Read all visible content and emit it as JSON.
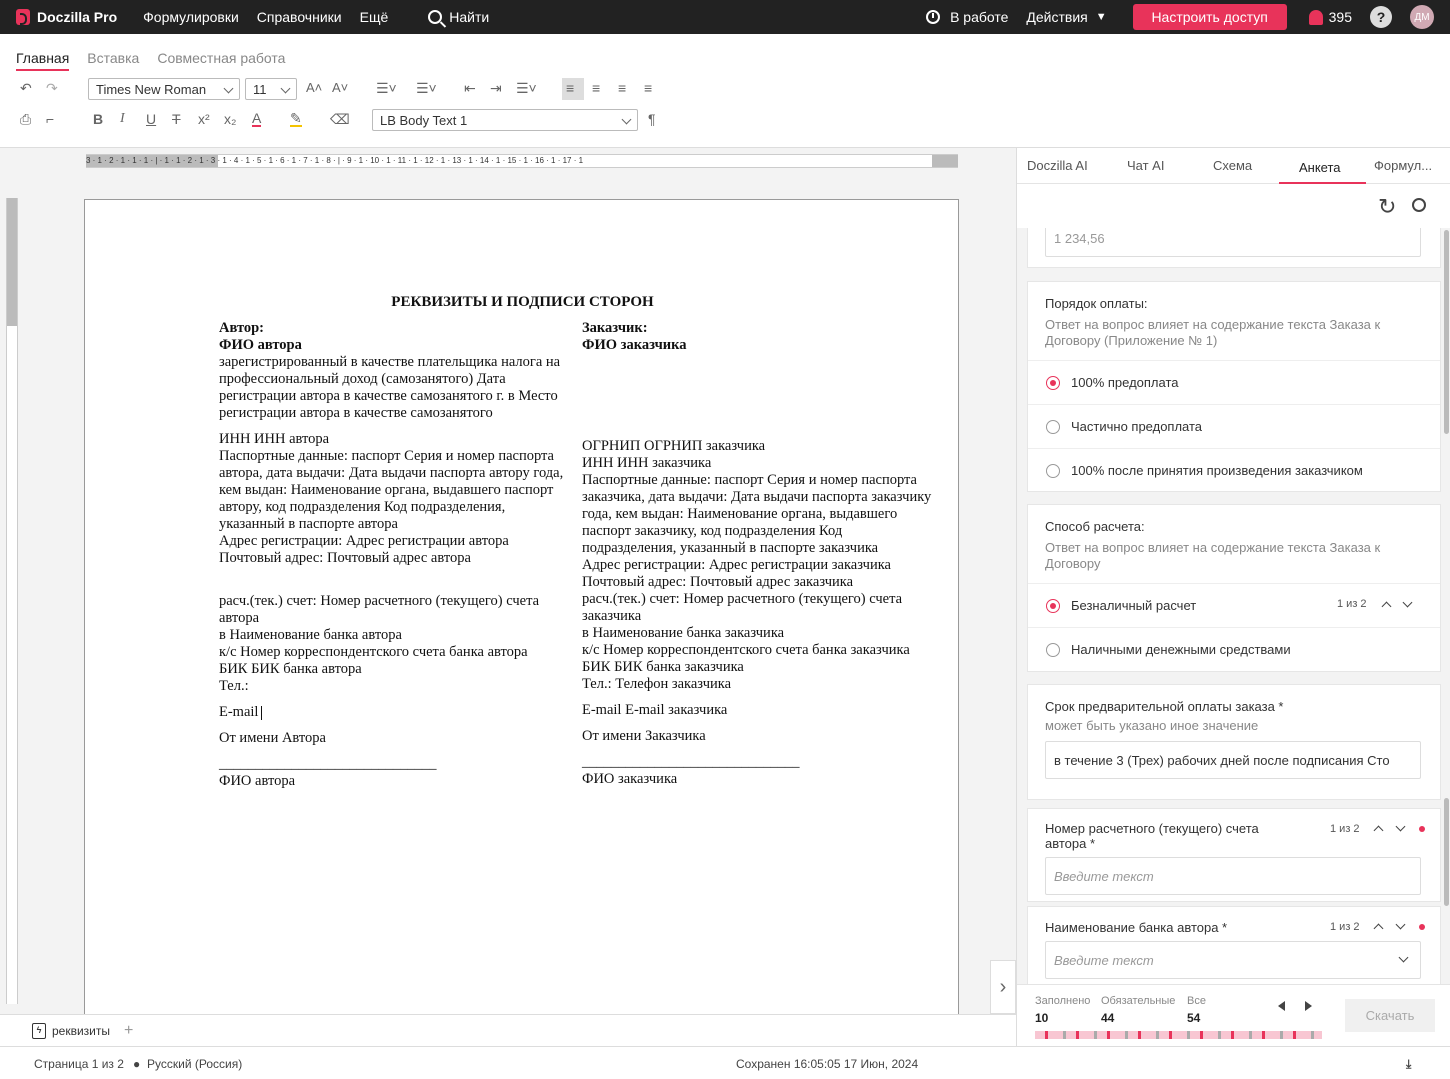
{
  "topbar": {
    "app_name": "Doczilla Pro",
    "nav": [
      "Формулировки",
      "Справочники",
      "Ещё"
    ],
    "search_label": "Найти",
    "status_label": "В работе",
    "actions_label": "Действия",
    "access_button": "Настроить доступ",
    "notifications_count": "395",
    "help_label": "?",
    "avatar_initials": "ДМ",
    "accent_color": "#e8335a"
  },
  "ribbon": {
    "tabs": [
      "Главная",
      "Вставка",
      "Совместная работа"
    ],
    "font_family": "Times New Roman",
    "font_size": "11",
    "style": "LB Body Text 1",
    "pilcrow": "¶"
  },
  "document": {
    "ruler_text": "3 · 1 · 2 · 1 · 1 · 1 · | · 1 · 1 · 2 · 1 · 3 · 1 · 4 · 1 · 5 · 1 · 6 · 1 · 7 · 1 · 8 · | · 9 · 1 · 10 · 1 · 11 · 1 · 12 · 1 · 13 · 1 · 14 · 1 · 15 · 1 · 16 · 1 · 17 · 1",
    "title": "РЕКВИЗИТЫ И ПОДПИСИ СТОРОН",
    "author": {
      "heading": "Автор:",
      "name_field": "ФИО автора",
      "reg_text": "зарегистрированный в качестве плательщика налога на профессиональный доход (самозанятого)",
      "reg_date_field": "Дата регистрации автора в качестве самозанятого",
      "reg_city_prefix": "г. в",
      "reg_place_field": "Место регистрации автора в качестве самозанятого",
      "inn_prefix": "ИНН",
      "inn_field": "ИНН автора",
      "passport_prefix": "Паспортные данные: паспорт",
      "passport_series_field": "Серия и номер паспорта автора",
      "issued_label": ", дата выдачи:",
      "issued_date_field": "Дата выдачи паспорта автору",
      "issued_by_label": "года, кем выдан:",
      "issuer_field": "Наименование органа, выдавшего паспорт автору",
      "code_label": ", код подразделения",
      "code_field": "Код подразделения, указанный в паспорте автора",
      "address_label": "Адрес регистрации:",
      "address_field": "Адрес регистрации автора",
      "postal_label": "Почтовый адрес:",
      "postal_field": "Почтовый адрес автора",
      "account_label": "расч.(тек.) счет:",
      "account_field": "Номер расчетного (текущего) счета автора",
      "bank_prefix": "в",
      "bank_field": "Наименование банка автора",
      "corr_label": "к/с",
      "corr_field": "Номер корреспондентского счета банка автора",
      "bik_label": "БИК",
      "bik_field": "БИК банка автора",
      "phone_label": "Тел.:",
      "email_label": "E-mail",
      "on_behalf": "От имени Автора",
      "signature_line": "______________________________",
      "sign_name_field": "ФИО автора"
    },
    "customer": {
      "heading": "Заказчик:",
      "name_field": "ФИО заказчика",
      "ogrnip_prefix": "ОГРНИП",
      "ogrnip_field": "ОГРНИП заказчика",
      "inn_prefix": "ИНН",
      "inn_field": "ИНН заказчика",
      "passport_prefix": "Паспортные данные: паспорт",
      "passport_series_field": "Серия и номер паспорта заказчика",
      "issued_label": ", дата выдачи:",
      "issued_date_field": "Дата выдачи паспорта заказчику",
      "issued_by_label": "года, кем выдан:",
      "issuer_field": "Наименование органа, выдавшего паспорт заказчику",
      "code_label": ", код подразделения",
      "code_field": "Код подразделения, указанный в паспорте заказчика",
      "address_label": "Адрес регистрации:",
      "address_field": "Адрес регистрации заказчика",
      "postal_label": "Почтовый адрес:",
      "postal_field": "Почтовый адрес заказчика",
      "account_label": "расч.(тек.) счет:",
      "account_field": "Номер расчетного (текущего) счета заказчика",
      "bank_prefix": "в",
      "bank_field": "Наименование банка заказчика",
      "corr_label": "к/с",
      "corr_field": "Номер корреспондентского счета банка заказчика",
      "bik_label": "БИК",
      "bik_field": "БИК банка заказчика",
      "phone_label": "Тел.:",
      "phone_field": "Телефон заказчика",
      "email_label": "E-mail",
      "email_field": "E-mail заказчика",
      "on_behalf": "От имени Заказчика",
      "signature_line": "______________________________",
      "sign_name_field": "ФИО заказчика"
    },
    "tab_name": "реквизиты"
  },
  "statusbar": {
    "page": "Страница 1 из 2",
    "language": "Русский (Россия)",
    "saved": "Сохранен 16:05:05 17 Июн, 2024"
  },
  "sidebar": {
    "tabs": [
      "Doczilla AI",
      "Чат AI",
      "Схема",
      "Анкета",
      "Формул..."
    ],
    "active_tab": "Анкета",
    "top_input_placeholder": "1 234,56",
    "payment_order": {
      "question": "Порядок оплаты:",
      "hint": "Ответ на вопрос влияет на содержание текста Заказа к Договору (Приложение № 1)",
      "options": [
        "100% предоплата",
        "Частично предоплата",
        "100% после принятия произведения заказчиком"
      ],
      "selected": 0
    },
    "payment_method": {
      "question": "Способ расчета:",
      "hint": "Ответ на вопрос влияет на содержание текста Заказа к Договору",
      "options": [
        "Безналичный расчет",
        "Наличными денежными средствами"
      ],
      "selected": 0,
      "counter": "1 из 2"
    },
    "prepay_term": {
      "question": "Срок предварительной оплаты заказа *",
      "hint": "может быть указано иное значение",
      "value": "в течение 3 (Трех) рабочих дней после подписания Сто"
    },
    "account_number": {
      "question": "Номер расчетного (текущего) счета автора *",
      "counter": "1 из 2",
      "placeholder": "Введите текст"
    },
    "bank_name": {
      "question": "Наименование банка автора *",
      "counter": "1 из 2",
      "placeholder": "Введите текст"
    },
    "progress": {
      "filled_label": "Заполнено",
      "filled": "10",
      "required_label": "Обязательные",
      "required": "44",
      "all_label": "Все",
      "all": "54",
      "download_button": "Скачать"
    }
  }
}
